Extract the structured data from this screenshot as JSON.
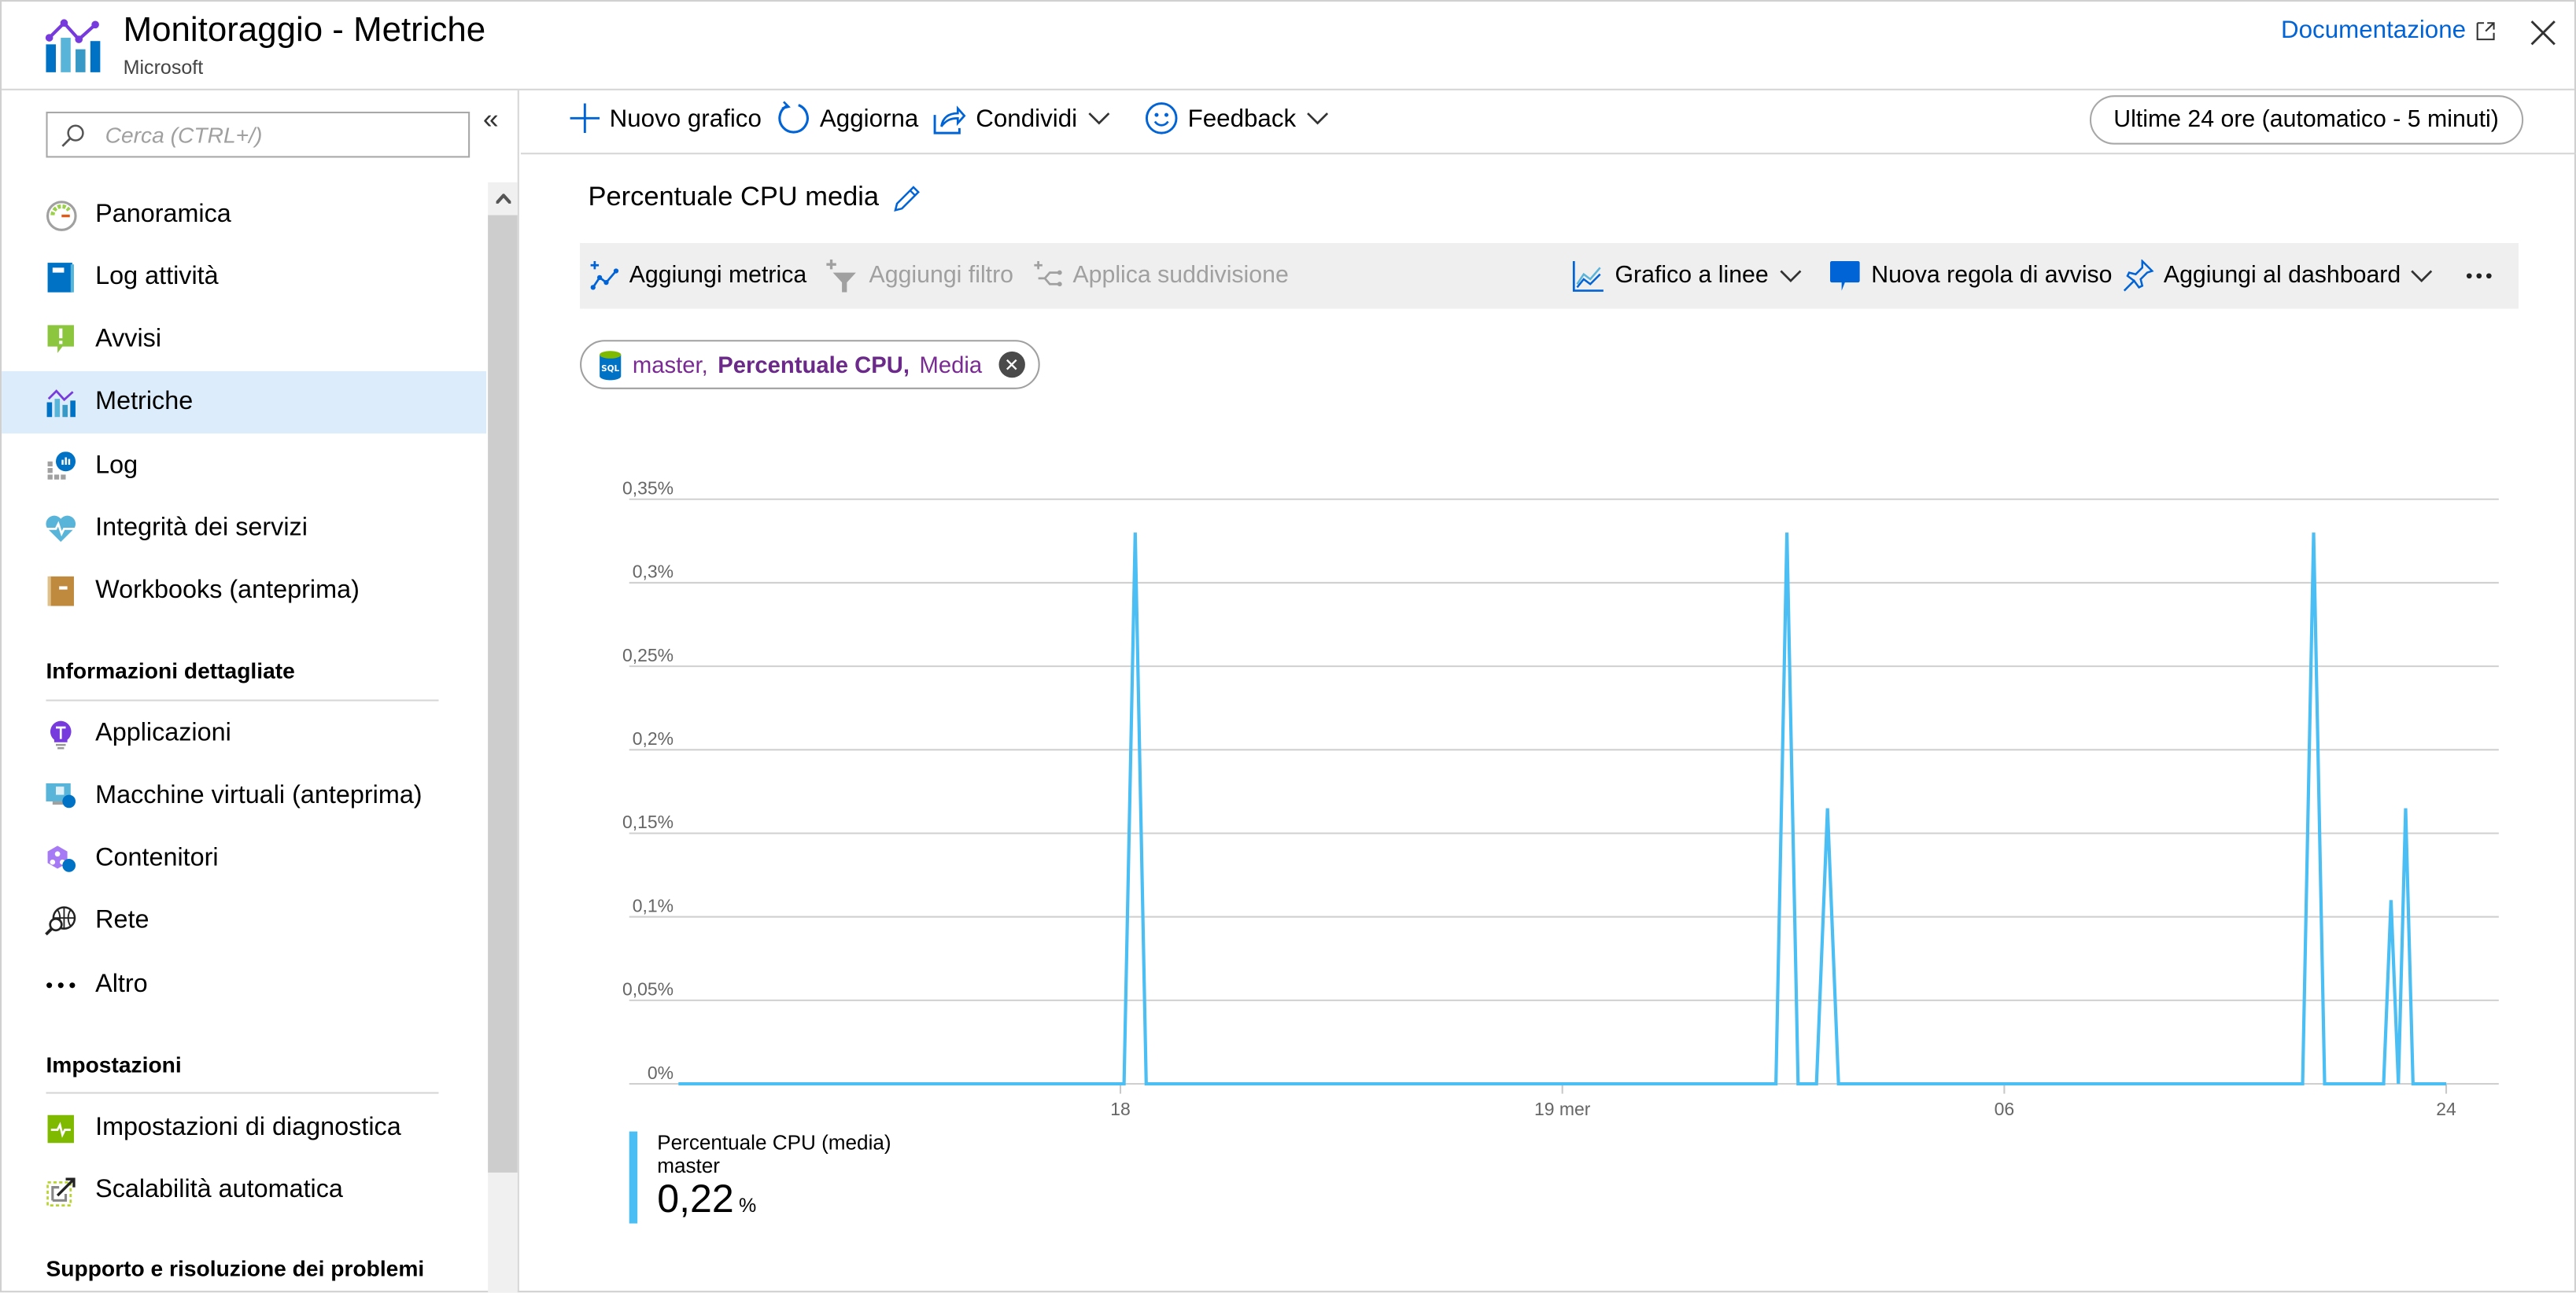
{
  "header": {
    "title": "Monitoraggio - Metriche",
    "subtitle": "Microsoft",
    "docs_link": "Documentazione",
    "close_icon": "close-icon"
  },
  "sidebar": {
    "search_placeholder": "Cerca (CTRL+/)",
    "collapse_icon": "double-chevron-left-icon",
    "items": [
      {
        "label": "Panoramica",
        "icon": "gauge-icon",
        "active": false
      },
      {
        "label": "Log attività",
        "icon": "activity-log-book-icon",
        "active": false
      },
      {
        "label": "Avvisi",
        "icon": "alert-icon",
        "active": false
      },
      {
        "label": "Metriche",
        "icon": "metrics-chart-icon",
        "active": true
      },
      {
        "label": "Log",
        "icon": "logs-icon",
        "active": false
      },
      {
        "label": "Integrità dei servizi",
        "icon": "heart-pulse-icon",
        "active": false
      },
      {
        "label": "Workbooks (anteprima)",
        "icon": "workbook-icon",
        "active": false
      }
    ],
    "section_insights": "Informazioni dettagliate",
    "insights_items": [
      {
        "label": "Applicazioni",
        "icon": "lightbulb-icon"
      },
      {
        "label": "Macchine virtuali (anteprima)",
        "icon": "vm-monitor-icon"
      },
      {
        "label": "Contenitori",
        "icon": "containers-icon"
      },
      {
        "label": "Rete",
        "icon": "network-globe-icon"
      },
      {
        "label": "Altro",
        "icon": "ellipsis-icon"
      }
    ],
    "section_settings": "Impostazioni",
    "settings_items": [
      {
        "label": "Impostazioni di diagnostica",
        "icon": "diagnostics-icon"
      },
      {
        "label": "Scalabilità automatica",
        "icon": "autoscale-icon"
      }
    ],
    "section_support": "Supporto e risoluzione dei problemi"
  },
  "commandbar": {
    "new_chart": "Nuovo grafico",
    "refresh": "Aggiorna",
    "share": "Condividi",
    "feedback": "Feedback",
    "time_range": "Ultime 24 ore (automatico - 5 minuti)"
  },
  "chart_panel": {
    "title": "Percentuale CPU media",
    "toolbar": {
      "add_metric": "Aggiungi metrica",
      "add_filter": "Aggiungi filtro",
      "apply_splitting": "Applica suddivisione",
      "chart_type": "Grafico a linee",
      "new_alert_rule": "Nuova regola di avviso",
      "pin_dashboard": "Aggiungi al dashboard",
      "more": "..."
    },
    "chip": {
      "resource": "master,",
      "metric": "Percentuale CPU,",
      "aggregation": "Media",
      "icon_text": "SQL"
    },
    "legend": {
      "metric": "Percentuale CPU (media)",
      "resource": "master",
      "value": "0,22",
      "unit": "%"
    }
  },
  "colors": {
    "accent": "#0063d6",
    "series": "#4bbef3",
    "active_nav": "#dcecfb",
    "chip_text": "#7a2b93"
  },
  "chart_data": {
    "type": "line",
    "title": "Percentuale CPU media",
    "xlabel": "",
    "ylabel": "",
    "ylim": [
      0,
      0.35
    ],
    "yticks": [
      0,
      0.05,
      0.1,
      0.15,
      0.2,
      0.25,
      0.3,
      0.35
    ],
    "ytick_labels": [
      "0%",
      "0,05%",
      "0,1%",
      "0,15%",
      "0,2%",
      "0,25%",
      "0,3%",
      "0,35%"
    ],
    "xlim_hours": [
      0,
      24
    ],
    "xtick_hours": [
      6,
      12,
      18,
      24
    ],
    "xtick_labels": [
      "18",
      "19 mer",
      "06",
      "24"
    ],
    "grid": true,
    "legend_position": "bottom-left",
    "series": [
      {
        "name": "Percentuale CPU (media) master",
        "unit": "%",
        "points_hours": [
          [
            0,
            0
          ],
          [
            6.05,
            0
          ],
          [
            6.2,
            0.33
          ],
          [
            6.35,
            0
          ],
          [
            14.9,
            0
          ],
          [
            15.05,
            0.33
          ],
          [
            15.2,
            0
          ],
          [
            15.45,
            0
          ],
          [
            15.6,
            0.165
          ],
          [
            15.75,
            0
          ],
          [
            22.05,
            0
          ],
          [
            22.2,
            0.33
          ],
          [
            22.35,
            0
          ],
          [
            23.15,
            0
          ],
          [
            23.25,
            0.11
          ],
          [
            23.35,
            0
          ],
          [
            23.45,
            0.165
          ],
          [
            23.55,
            0
          ],
          [
            24,
            0
          ]
        ]
      }
    ]
  }
}
